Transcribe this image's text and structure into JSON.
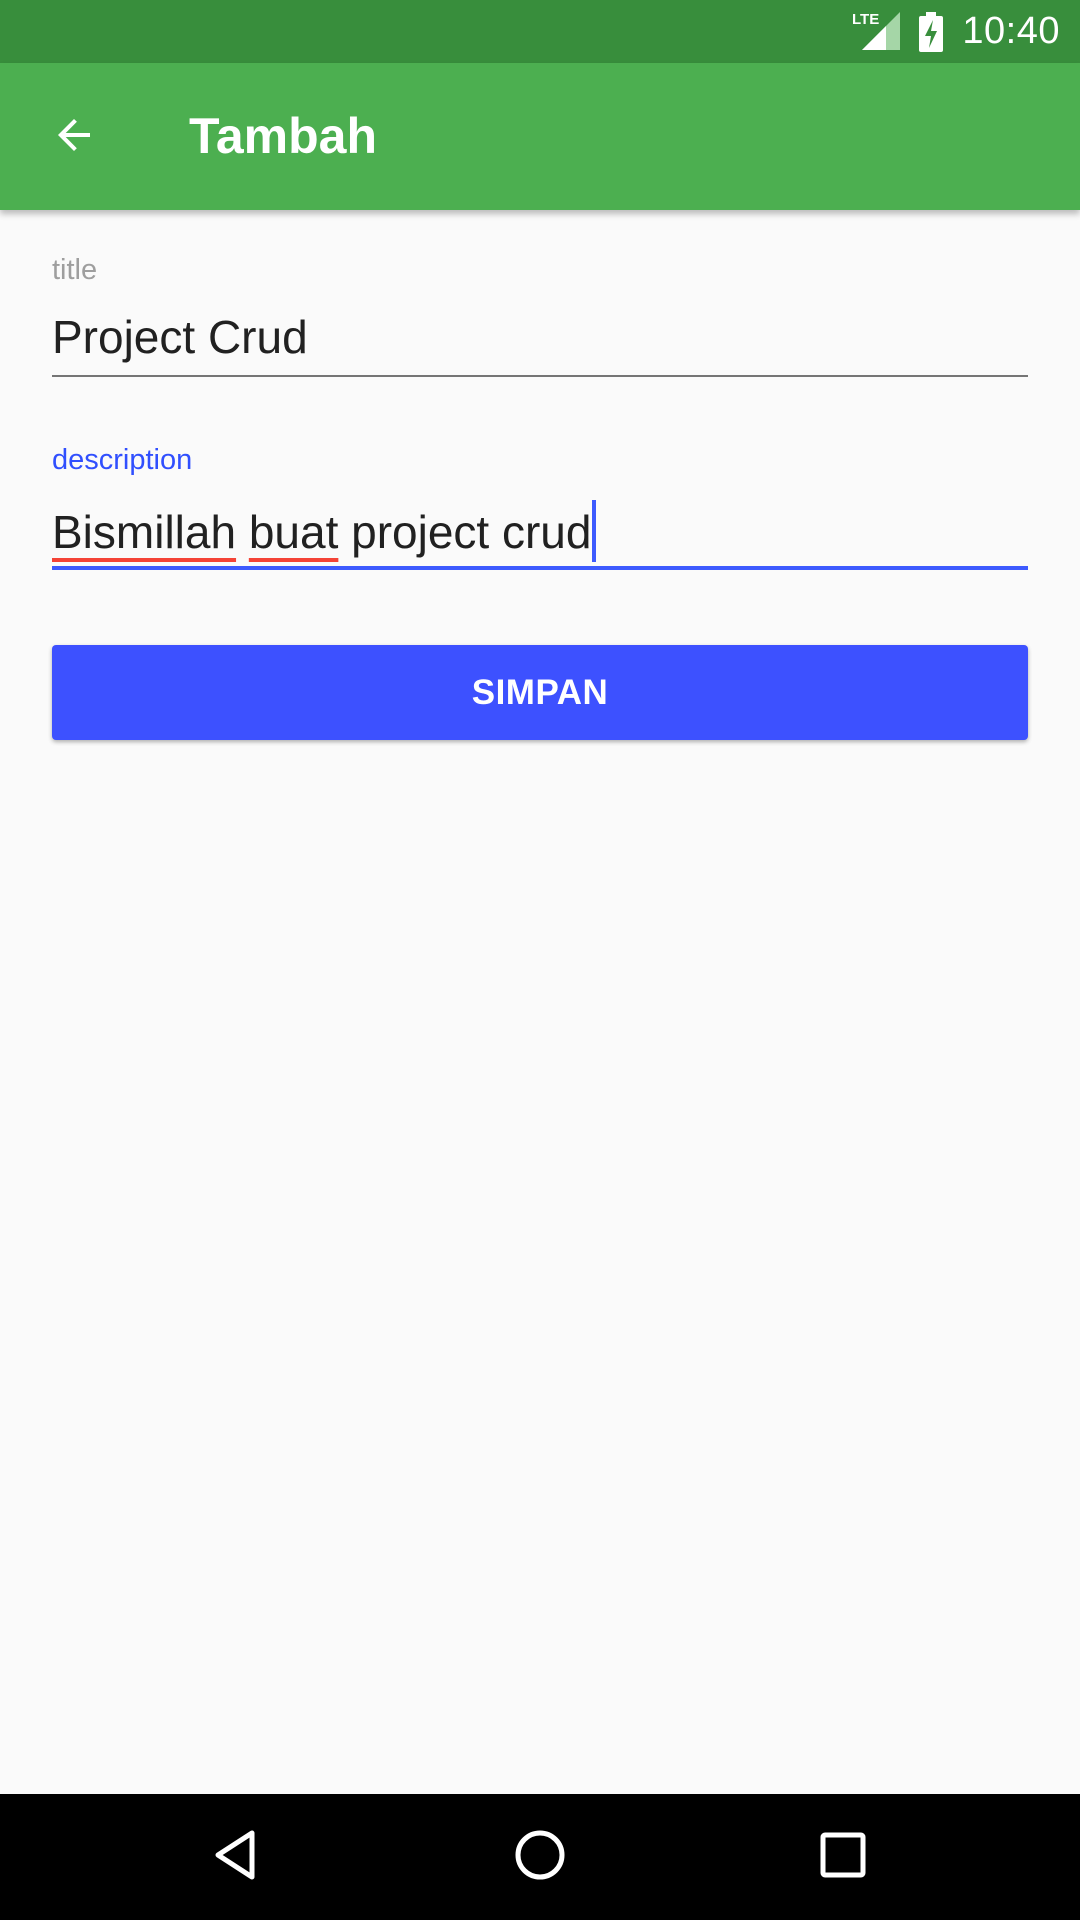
{
  "status_bar": {
    "network": "LTE",
    "time": "10:40",
    "icons": [
      "lte-signal-icon",
      "battery-charging-icon"
    ]
  },
  "app_bar": {
    "title": "Tambah",
    "back_icon": "arrow-back-icon"
  },
  "form": {
    "title_field": {
      "label": "title",
      "value": "Project Crud"
    },
    "description_field": {
      "label": "description",
      "value_words": {
        "word1": "Bismillah",
        "word2": "buat",
        "rest": "project crud"
      }
    },
    "save_label": "SIMPAN"
  },
  "nav_bar": {
    "icons": [
      "back-triangle-icon",
      "home-circle-icon",
      "recents-square-icon"
    ]
  },
  "colors": {
    "status_bar": "#388e3c",
    "app_bar": "#4caf50",
    "accent": "#3d5afe",
    "button": "#3d51ff",
    "spell_error": "#f44336"
  }
}
